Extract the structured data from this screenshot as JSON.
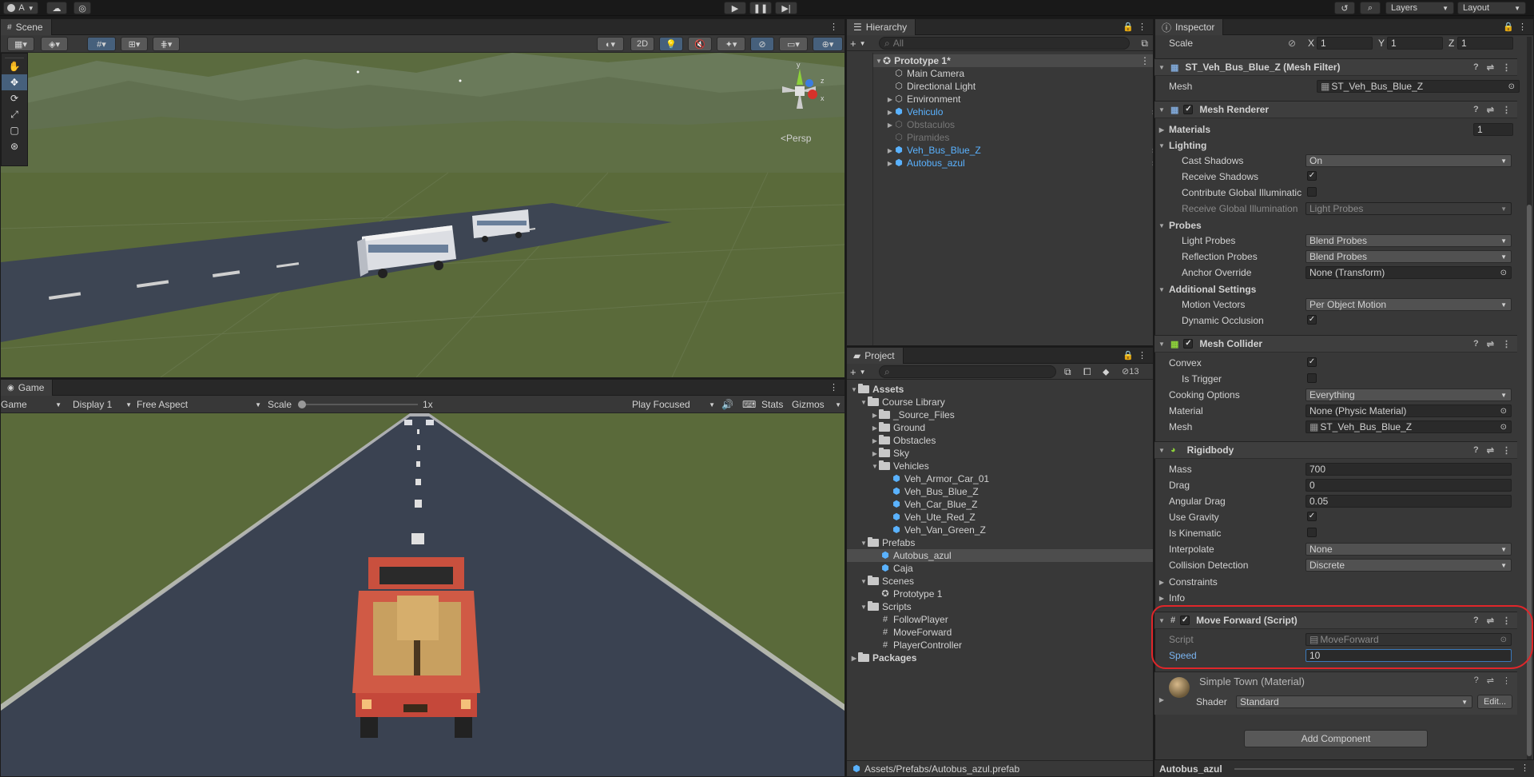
{
  "topbar": {
    "account_label": "A",
    "layers_label": "Layers",
    "layout_label": "Layout"
  },
  "scene": {
    "tab": "Scene",
    "btn_2d": "2D",
    "persp_label": "Persp",
    "gizmo_axes": {
      "y": "y",
      "z": "z",
      "x": "x"
    }
  },
  "game": {
    "tab": "Game",
    "mode": "Game",
    "display": "Display 1",
    "aspect": "Free Aspect",
    "scale_label": "Scale",
    "scale_value": "1x",
    "play_focused": "Play Focused",
    "stats": "Stats",
    "gizmos": "Gizmos"
  },
  "hierarchy": {
    "tab": "Hierarchy",
    "search_placeholder": "All",
    "scene_name": "Prototype 1*",
    "items": [
      {
        "label": "Main Camera"
      },
      {
        "label": "Directional Light"
      },
      {
        "label": "Environment"
      },
      {
        "label": "Vehiculo"
      },
      {
        "label": "Obstaculos"
      },
      {
        "label": "Piramides"
      },
      {
        "label": "Veh_Bus_Blue_Z"
      },
      {
        "label": "Autobus_azul"
      }
    ]
  },
  "project": {
    "tab": "Project",
    "hidden_count": "13",
    "tree": [
      {
        "label": "Assets"
      },
      {
        "label": "Course Library"
      },
      {
        "label": "_Source_Files"
      },
      {
        "label": "Ground"
      },
      {
        "label": "Obstacles"
      },
      {
        "label": "Sky"
      },
      {
        "label": "Vehicles"
      },
      {
        "label": "Veh_Armor_Car_01"
      },
      {
        "label": "Veh_Bus_Blue_Z"
      },
      {
        "label": "Veh_Car_Blue_Z"
      },
      {
        "label": "Veh_Ute_Red_Z"
      },
      {
        "label": "Veh_Van_Green_Z"
      },
      {
        "label": "Prefabs"
      },
      {
        "label": "Autobus_azul"
      },
      {
        "label": "Caja"
      },
      {
        "label": "Scenes"
      },
      {
        "label": "Prototype 1"
      },
      {
        "label": "Scripts"
      },
      {
        "label": "FollowPlayer"
      },
      {
        "label": "MoveForward"
      },
      {
        "label": "PlayerController"
      },
      {
        "label": "Packages"
      }
    ],
    "status_path": "Assets/Prefabs/Autobus_azul.prefab"
  },
  "inspector": {
    "tab": "Inspector",
    "scale": {
      "label": "Scale",
      "x_label": "X",
      "x": "1",
      "y_label": "Y",
      "y": "1",
      "z_label": "Z",
      "z": "1"
    },
    "mesh_filter": {
      "title": "ST_Veh_Bus_Blue_Z (Mesh Filter)",
      "mesh_label": "Mesh",
      "mesh_value": "ST_Veh_Bus_Blue_Z"
    },
    "mesh_renderer": {
      "title": "Mesh Renderer",
      "materials_label": "Materials",
      "materials_count": "1",
      "lighting_label": "Lighting",
      "cast_shadows_label": "Cast Shadows",
      "cast_shadows_value": "On",
      "receive_shadows_label": "Receive Shadows",
      "contribute_gi_label": "Contribute Global Illuminatic",
      "receive_gi_label": "Receive Global Illumination",
      "receive_gi_value": "Light Probes",
      "probes_label": "Probes",
      "light_probes_label": "Light Probes",
      "light_probes_value": "Blend Probes",
      "reflection_probes_label": "Reflection Probes",
      "reflection_probes_value": "Blend Probes",
      "anchor_override_label": "Anchor Override",
      "anchor_override_value": "None (Transform)",
      "additional_label": "Additional Settings",
      "motion_vectors_label": "Motion Vectors",
      "motion_vectors_value": "Per Object Motion",
      "dynamic_occlusion_label": "Dynamic Occlusion"
    },
    "mesh_collider": {
      "title": "Mesh Collider",
      "convex_label": "Convex",
      "is_trigger_label": "Is Trigger",
      "cooking_label": "Cooking Options",
      "cooking_value": "Everything",
      "material_label": "Material",
      "material_value": "None (Physic Material)",
      "mesh_label": "Mesh",
      "mesh_value": "ST_Veh_Bus_Blue_Z"
    },
    "rigidbody": {
      "title": "Rigidbody",
      "mass_label": "Mass",
      "mass": "700",
      "drag_label": "Drag",
      "drag": "0",
      "angular_drag_label": "Angular Drag",
      "angular_drag": "0.05",
      "use_gravity_label": "Use Gravity",
      "is_kinematic_label": "Is Kinematic",
      "interpolate_label": "Interpolate",
      "interpolate": "None",
      "collision_label": "Collision Detection",
      "collision": "Discrete",
      "constraints_label": "Constraints",
      "info_label": "Info"
    },
    "move_forward": {
      "title": "Move Forward (Script)",
      "script_label": "Script",
      "script_value": "MoveForward",
      "speed_label": "Speed",
      "speed_value": "10"
    },
    "material": {
      "title": "Simple Town (Material)",
      "shader_label": "Shader",
      "shader_value": "Standard",
      "edit_label": "Edit..."
    },
    "add_component": "Add Component",
    "footer_name": "Autobus_azul"
  },
  "colors": {
    "highlight_red": "#e0262a",
    "prefab_blue": "#5ab2ff",
    "ground": "#5a6a3a"
  }
}
